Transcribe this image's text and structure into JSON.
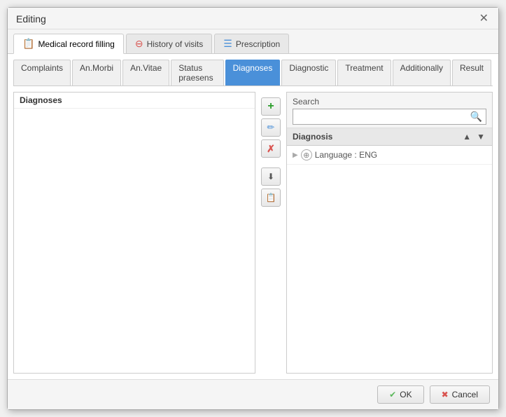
{
  "dialog": {
    "title": "Editing",
    "close_label": "✕"
  },
  "top_tabs": [
    {
      "id": "medical-record",
      "label": "Medical record filling",
      "icon": "📋",
      "icon_type": "doc",
      "active": true
    },
    {
      "id": "history-visits",
      "label": "History of visits",
      "icon": "⊖",
      "icon_type": "red",
      "active": false
    },
    {
      "id": "prescription",
      "label": "Prescription",
      "icon": "≡",
      "icon_type": "list",
      "active": false
    }
  ],
  "sub_tabs": [
    {
      "id": "complaints",
      "label": "Complaints",
      "active": false
    },
    {
      "id": "an-morbi",
      "label": "An.Morbi",
      "active": false
    },
    {
      "id": "an-vitae",
      "label": "An.Vitae",
      "active": false
    },
    {
      "id": "status-praesens",
      "label": "Status praesens",
      "active": false
    },
    {
      "id": "diagnoses",
      "label": "Diagnoses",
      "active": true
    },
    {
      "id": "diagnostic",
      "label": "Diagnostic",
      "active": false
    },
    {
      "id": "treatment",
      "label": "Treatment",
      "active": false
    },
    {
      "id": "additionally",
      "label": "Additionally",
      "active": false
    },
    {
      "id": "result",
      "label": "Result",
      "active": false
    }
  ],
  "left_panel": {
    "header": "Diagnoses"
  },
  "buttons": [
    {
      "id": "add",
      "icon": "➕",
      "label": "Add",
      "color": "green"
    },
    {
      "id": "edit",
      "icon": "✏️",
      "label": "Edit",
      "color": "blue"
    },
    {
      "id": "delete",
      "icon": "✗",
      "label": "Delete",
      "color": "red"
    },
    {
      "id": "move-down",
      "icon": "⬇",
      "label": "Move Down",
      "spacer": true
    },
    {
      "id": "copy",
      "icon": "📋",
      "label": "Copy"
    }
  ],
  "right_panel": {
    "search_label": "Search",
    "search_placeholder": "",
    "tree_header": "Diagnosis",
    "tree_nodes": [
      {
        "id": "lang-eng",
        "label": "Language : ENG",
        "expandable": true
      }
    ]
  },
  "footer": {
    "ok_label": "OK",
    "cancel_label": "Cancel"
  }
}
